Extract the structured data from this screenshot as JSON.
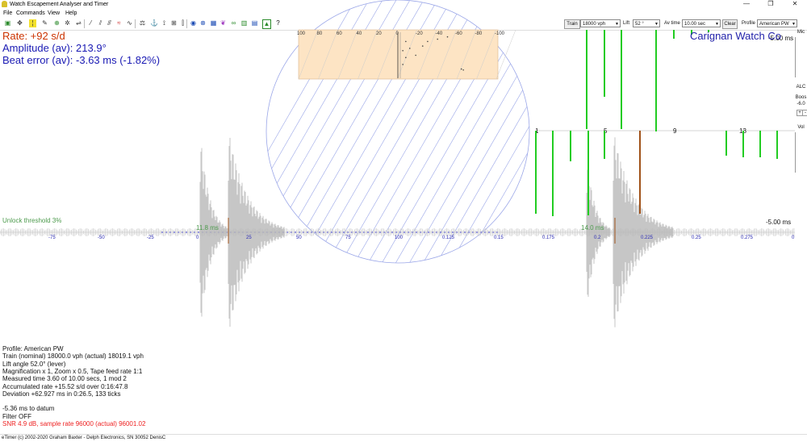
{
  "window": {
    "title": "Watch Escapement Analyser and Timer",
    "min_glyph": "—",
    "restore_glyph": "❐",
    "close_glyph": "✕"
  },
  "menu": [
    "File",
    "Commands",
    "View",
    "Help"
  ],
  "toolbar": {
    "train_button": "Train",
    "train_value": "18000 vph",
    "lift_label": "Lift",
    "lift_value": "52 °",
    "avtime_label": "Av time",
    "avtime_value": "10.00 sec",
    "clear_button": "Clear",
    "profile_label": "Profile",
    "profile_value": "American PW"
  },
  "readouts": {
    "rate": "Rate: +92 s/d",
    "amplitude": "Amplitude (av): 213.9°",
    "beat_error": "Beat error (av): -3.63 ms (-1.82%)"
  },
  "brand": "Carignan Watch Co",
  "threshold_label": "Unlock threshold 3%",
  "polar": {
    "ticks": [
      "100",
      "80",
      "60",
      "40",
      "20",
      "0",
      "-20",
      "-40",
      "-60",
      "-80",
      "-100"
    ],
    "points": [
      [
        -5,
        0.4
      ],
      [
        -8,
        0.55
      ],
      [
        -12,
        0.35
      ],
      [
        -18,
        0.5
      ],
      [
        -25,
        0.3
      ],
      [
        -30,
        0.2
      ],
      [
        -40,
        0.15
      ],
      [
        -50,
        0.1
      ],
      [
        -64,
        0.8
      ],
      [
        -66,
        0.82
      ],
      [
        -5,
        0.7
      ],
      [
        -8,
        0.2
      ]
    ]
  },
  "scope": {
    "labels_left": [
      "-75",
      "-50",
      "-25",
      "0",
      "25",
      "50",
      "75",
      "100"
    ],
    "labels_right": [
      "0.125",
      "0.15",
      "0.175",
      "0.2",
      "0.225",
      "0.25",
      "0.275",
      "0"
    ],
    "marker_left": "11.8 ms",
    "marker_right": "14.0 ms",
    "scale_top": "-5.00 ms",
    "scale_mid": "-5.00 ms",
    "tick_numbers": [
      "1",
      "5",
      "9",
      "13"
    ]
  },
  "bars": {
    "green_top": [
      [
        813,
        163
      ],
      [
        835,
        48
      ],
      [
        857,
        43
      ],
      [
        878,
        40
      ]
    ],
    "green_mid": [
      [
        664,
        265
      ],
      [
        685,
        268
      ],
      [
        707,
        200
      ],
      [
        729,
        267
      ],
      [
        749,
        197
      ],
      [
        900,
        193
      ],
      [
        921,
        195
      ],
      [
        942,
        195
      ],
      [
        963,
        197
      ]
    ],
    "green_hi": [
      [
        727,
        37
      ],
      [
        749,
        37
      ],
      [
        770,
        37
      ]
    ],
    "brown": [
      [
        793,
        265
      ]
    ]
  },
  "info_lines": [
    "Profile: American PW",
    "Train (nominal) 18000.0 vph (actual) 18019.1 vph",
    "Lift angle 52.0° (lever)",
    "Magnification x 1, Zoom x 0.5, Tape feed rate 1:1",
    "Measured time 3.60 of 10.00 secs, 1 mod 2",
    "Accumulated rate +15.52 s/d over 0:16:47.8",
    "Deviation +62.927 ms in 0:26.5, 133 ticks",
    "",
    "-5.36 ms to datum",
    "Filter OFF",
    "SNR 4.9 dB, sample rate 96000 (actual) 96001.02"
  ],
  "status": "eTimer (c) 2002-2020 Graham Baxter - Delph Electronics, SN 30052 DenisC",
  "right_panel": [
    "Mic",
    "ALC",
    "Boos",
    "-6.0",
    "+",
    "-",
    "Vol"
  ],
  "colors": {
    "rate": "#cc3300",
    "blue": "#1a1ab4",
    "green": "#22cc22",
    "brown": "#a0521a",
    "threshold": "#4c9a4c",
    "snr": "#ee2222",
    "orange_box": "#fde4c4"
  }
}
